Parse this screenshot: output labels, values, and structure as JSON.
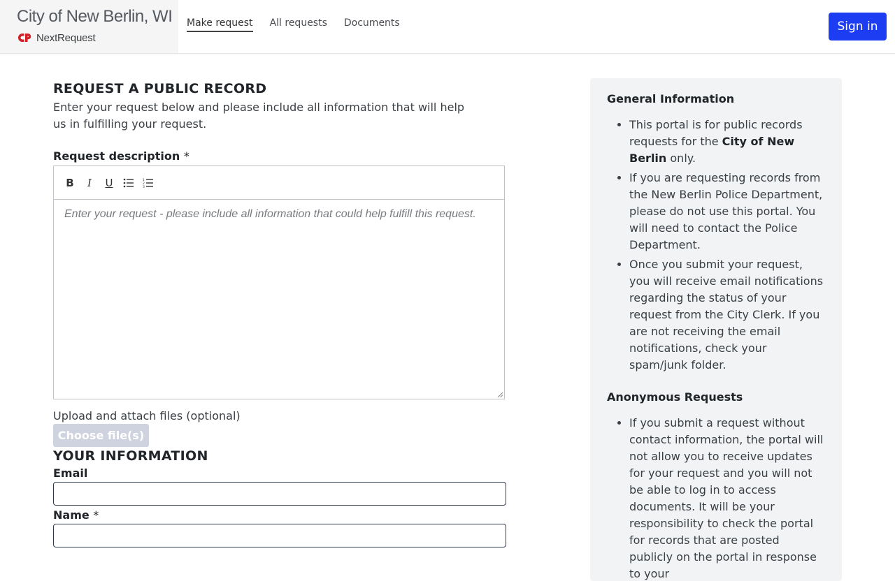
{
  "header": {
    "org_title": "City of New Berlin, WI",
    "brand_name": "NextRequest",
    "nav": [
      {
        "label": "Make request",
        "active": true
      },
      {
        "label": "All requests",
        "active": false
      },
      {
        "label": "Documents",
        "active": false
      }
    ],
    "signin_label": "Sign in"
  },
  "form": {
    "title": "REQUEST A PUBLIC RECORD",
    "intro": "Enter your request below and please include all information that will help us in fulfilling your request.",
    "description_label": "Request description",
    "required_mark": "*",
    "toolbar": {
      "bold": "B",
      "italic": "I",
      "underline": "U"
    },
    "description_placeholder": "Enter your request - please include all information that could help fulfill this request.",
    "upload_label": "Upload and attach files (optional)",
    "choose_files_label": "Choose file(s)",
    "your_info_title": "YOUR INFORMATION",
    "email_label": "Email",
    "email_value": "",
    "name_label": "Name",
    "name_value": ""
  },
  "sidebar": {
    "general_heading": "General Information",
    "general_items": [
      {
        "pre": "This portal is for public records requests for the ",
        "strong": "City of New Berlin",
        "post": " only."
      },
      {
        "pre": "If you are requesting records from the New Berlin Police Department, please do not use this portal. You will need to contact the Police Department.",
        "strong": "",
        "post": ""
      },
      {
        "pre": "Once you submit your request, you will receive email notifications regarding the status of your request from the City Clerk. If you are not receiving the email notifications, check your spam/junk folder.",
        "strong": "",
        "post": ""
      }
    ],
    "anon_heading": "Anonymous Requests",
    "anon_items": [
      {
        "text": "If you submit a request without contact information, the portal will not allow you to receive updates for your request and you will not be able to log in to access documents. It will be your responsibility to check the portal for records that are posted publicly on the portal in response to your"
      }
    ]
  },
  "colors": {
    "signin_bg": "#1d3df2",
    "choose_btn_bg": "#cfd3e0",
    "sidebar_bg": "#f2f3f5",
    "logo_red": "#d22027"
  }
}
